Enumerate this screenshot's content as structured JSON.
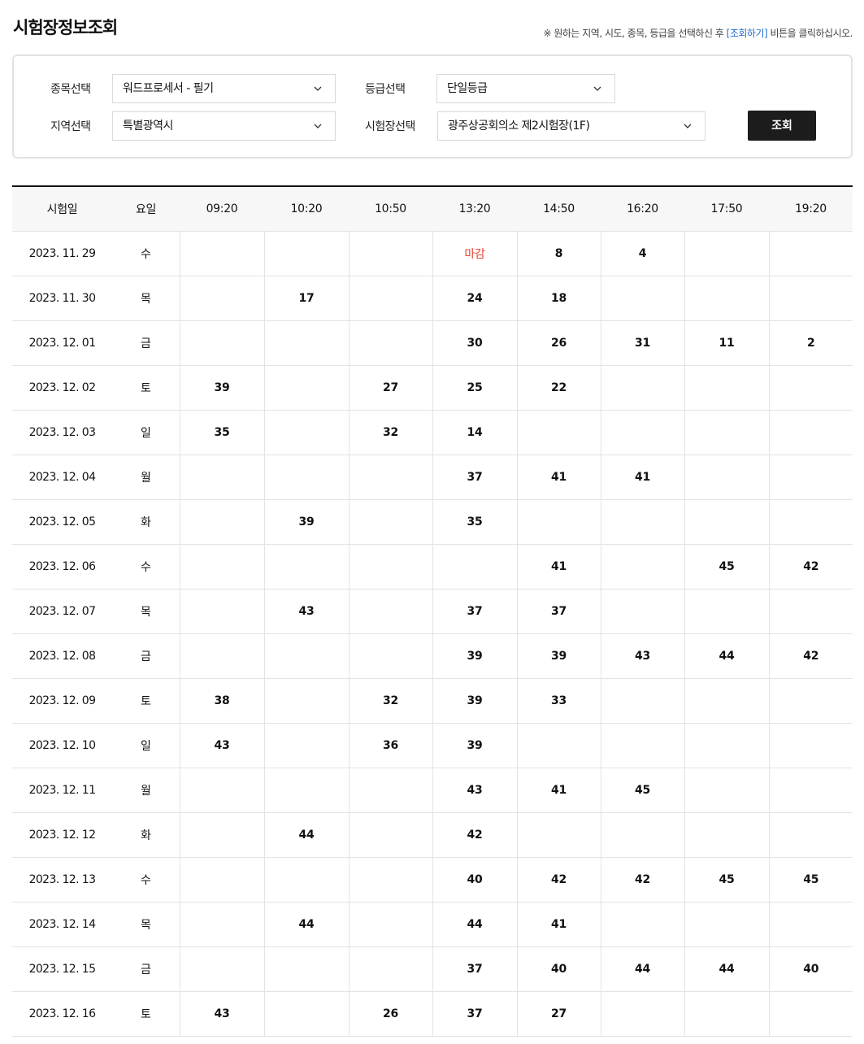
{
  "page": {
    "title": "시험장정보조회",
    "notice_prefix": "※ 원하는 지역, 시도, 종목, 등급을 선택하신 후 ",
    "notice_link": "[조회하기]",
    "notice_suffix": " 비튼을 클릭하십시오."
  },
  "filters": {
    "subject": {
      "label": "종목선택",
      "value": "워드프로세서 - 필기"
    },
    "grade": {
      "label": "등급선택",
      "value": "단일등급"
    },
    "region": {
      "label": "지역선택",
      "value": "특별광역시"
    },
    "site": {
      "label": "시험장선택",
      "value": "광주상공회의소 제2시험장(1F)"
    },
    "query_button": "조회"
  },
  "table": {
    "headers": [
      "시험일",
      "요일",
      "09:20",
      "10:20",
      "10:50",
      "13:20",
      "14:50",
      "16:20",
      "17:50",
      "19:20"
    ],
    "rows": [
      {
        "date": "2023. 11. 29",
        "day": "수",
        "slots": [
          "",
          "",
          "",
          "마감",
          "8",
          "4",
          "",
          ""
        ]
      },
      {
        "date": "2023. 11. 30",
        "day": "목",
        "slots": [
          "",
          "17",
          "",
          "24",
          "18",
          "",
          "",
          ""
        ]
      },
      {
        "date": "2023. 12. 01",
        "day": "금",
        "slots": [
          "",
          "",
          "",
          "30",
          "26",
          "31",
          "11",
          "2"
        ]
      },
      {
        "date": "2023. 12. 02",
        "day": "토",
        "slots": [
          "39",
          "",
          "27",
          "25",
          "22",
          "",
          "",
          ""
        ]
      },
      {
        "date": "2023. 12. 03",
        "day": "일",
        "slots": [
          "35",
          "",
          "32",
          "14",
          "",
          "",
          "",
          ""
        ]
      },
      {
        "date": "2023. 12. 04",
        "day": "월",
        "slots": [
          "",
          "",
          "",
          "37",
          "41",
          "41",
          "",
          ""
        ]
      },
      {
        "date": "2023. 12. 05",
        "day": "화",
        "slots": [
          "",
          "39",
          "",
          "35",
          "",
          "",
          "",
          ""
        ]
      },
      {
        "date": "2023. 12. 06",
        "day": "수",
        "slots": [
          "",
          "",
          "",
          "",
          "41",
          "",
          "45",
          "42"
        ]
      },
      {
        "date": "2023. 12. 07",
        "day": "목",
        "slots": [
          "",
          "43",
          "",
          "37",
          "37",
          "",
          "",
          ""
        ]
      },
      {
        "date": "2023. 12. 08",
        "day": "금",
        "slots": [
          "",
          "",
          "",
          "39",
          "39",
          "43",
          "44",
          "42"
        ]
      },
      {
        "date": "2023. 12. 09",
        "day": "토",
        "slots": [
          "38",
          "",
          "32",
          "39",
          "33",
          "",
          "",
          ""
        ]
      },
      {
        "date": "2023. 12. 10",
        "day": "일",
        "slots": [
          "43",
          "",
          "36",
          "39",
          "",
          "",
          "",
          ""
        ]
      },
      {
        "date": "2023. 12. 11",
        "day": "월",
        "slots": [
          "",
          "",
          "",
          "43",
          "41",
          "45",
          "",
          ""
        ]
      },
      {
        "date": "2023. 12. 12",
        "day": "화",
        "slots": [
          "",
          "44",
          "",
          "42",
          "",
          "",
          "",
          ""
        ]
      },
      {
        "date": "2023. 12. 13",
        "day": "수",
        "slots": [
          "",
          "",
          "",
          "40",
          "42",
          "42",
          "45",
          "45"
        ]
      },
      {
        "date": "2023. 12. 14",
        "day": "목",
        "slots": [
          "",
          "44",
          "",
          "44",
          "41",
          "",
          "",
          ""
        ]
      },
      {
        "date": "2023. 12. 15",
        "day": "금",
        "slots": [
          "",
          "",
          "",
          "37",
          "40",
          "44",
          "44",
          "40"
        ]
      },
      {
        "date": "2023. 12. 16",
        "day": "토",
        "slots": [
          "43",
          "",
          "26",
          "37",
          "27",
          "",
          "",
          ""
        ]
      }
    ],
    "closed_label": "마감"
  },
  "colors": {
    "accent": "#1f6fd1",
    "closed": "#e8412d",
    "button_bg": "#1c1c1c"
  }
}
